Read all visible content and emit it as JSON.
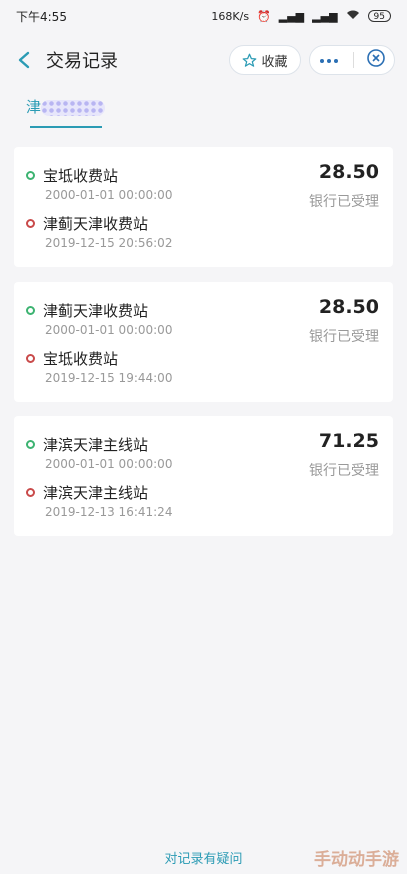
{
  "statusbar": {
    "time": "下午4:55",
    "speed": "168K/s",
    "battery": "95"
  },
  "header": {
    "title": "交易记录",
    "favorite_label": "收藏"
  },
  "tab": {
    "label": "津"
  },
  "records": [
    {
      "from_station": "宝坻收费站",
      "from_time": "2000-01-01 00:00:00",
      "to_station": "津蓟天津收费站",
      "to_time": "2019-12-15 20:56:02",
      "amount": "28.50",
      "status": "银行已受理"
    },
    {
      "from_station": "津蓟天津收费站",
      "from_time": "2000-01-01 00:00:00",
      "to_station": "宝坻收费站",
      "to_time": "2019-12-15 19:44:00",
      "amount": "28.50",
      "status": "银行已受理"
    },
    {
      "from_station": "津滨天津主线站",
      "from_time": "2000-01-01 00:00:00",
      "to_station": "津滨天津主线站",
      "to_time": "2019-12-13 16:41:24",
      "amount": "71.25",
      "status": "银行已受理"
    }
  ],
  "footer": {
    "link": "对记录有疑问"
  },
  "watermark": "手动动手游",
  "colors": {
    "accent": "#2b9bb4",
    "start_dot": "#3cb371",
    "end_dot": "#c94a4a"
  }
}
